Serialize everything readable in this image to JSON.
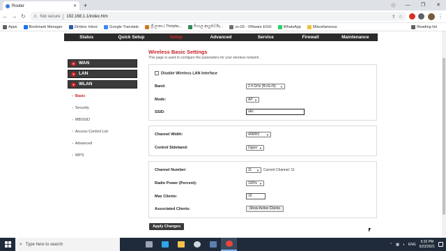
{
  "browser": {
    "tab_title": "Router",
    "not_secure": "Not secure",
    "url": "192.168.1.1/index.htm"
  },
  "bookmarks": {
    "items": [
      {
        "label": "Apps",
        "color": "#5f6368"
      },
      {
        "label": "Bookmark Manager",
        "color": "#1a73e8"
      },
      {
        "label": "Zimbra: Inbox",
        "color": "#2a5da8"
      },
      {
        "label": "Google Translate",
        "color": "#4285f4"
      },
      {
        "label": "ශ්‍රී ලංකා | Thripita...",
        "color": "#c97b1e"
      },
      {
        "label": "සිංහල ආයුර්වේද...",
        "color": "#2e8b57"
      },
      {
        "label": "vs-03 - VMware ESXi",
        "color": "#707070"
      },
      {
        "label": "WhatsApp",
        "color": "#25d366"
      },
      {
        "label": "Miscellaneous",
        "color": "#f1c232"
      }
    ],
    "reading_list": "Reading list"
  },
  "router": {
    "nav": [
      "Status",
      "Quick Setup",
      "Setup",
      "Advanced",
      "Service",
      "Firewall",
      "Maintenance"
    ],
    "sidebar": {
      "sections": [
        "WAN",
        "LAN",
        "WLAN"
      ],
      "sub": [
        "Basic",
        "Security",
        "MBSSID",
        "Access Control List",
        "Advanced",
        "WPS"
      ]
    },
    "title": "Wireless Basic Settings",
    "description": "This page is used to configure the parameters for your wireless network.",
    "disable_label": "Disable Wireless LAN Interface",
    "fields": {
      "band_label": "Band:",
      "band_value": "2.4 GHz (B+G+N)",
      "mode_label": "Mode:",
      "mode_value": "AP",
      "ssid_label": "SSID:",
      "ssid_value": "abc",
      "channel_width_label": "Channel Width:",
      "channel_width_value": "40MHZ",
      "sideband_label": "Control Sideband:",
      "sideband_value": "Upper",
      "channel_number_label": "Channel Number:",
      "channel_number_value": "11",
      "current_channel": "Current Channel: 11",
      "radio_power_label": "Radio Power (Percent):",
      "radio_power_value": "100%",
      "max_clients_label": "Max Clients:",
      "max_clients_value": "16",
      "assoc_clients_label": "Associated Clients:",
      "show_clients_button": "Show Active Clients"
    },
    "apply_button": "Apply Changes",
    "accent_color": "#c42026"
  },
  "taskbar": {
    "search_placeholder": "Type here to search",
    "lang": "ENG",
    "time": "5:32 PM",
    "date": "6/22/2021"
  }
}
